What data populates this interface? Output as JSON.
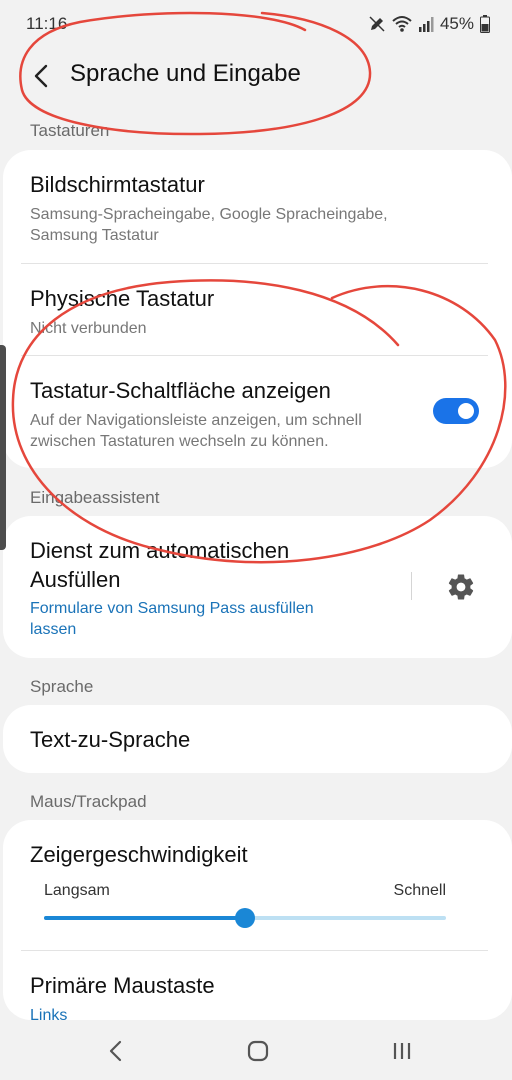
{
  "status_bar": {
    "time": "11:16",
    "battery": "45%",
    "icons": [
      "edit-pen-icon",
      "wifi-icon",
      "signal-icon",
      "battery-icon"
    ]
  },
  "header": {
    "title": "Sprache und Eingabe",
    "back_icon": "back-arrow-icon"
  },
  "sections": {
    "keyboards": "Tastaturen",
    "input_assistant": "Eingabeassistent",
    "language": "Sprache",
    "mouse": "Maus/Trackpad"
  },
  "keyboards_card": {
    "onscreen_title": "Bildschirmtastatur",
    "onscreen_sub_1": "Samsung-Spracheingabe, Google Spracheingabe,",
    "onscreen_sub_2": "Samsung Tastatur",
    "physical_title": "Physische Tastatur",
    "physical_sub": "Nicht verbunden",
    "show_button_title": "Tastatur-Schaltfläche anzeigen",
    "show_button_sub_1": "Auf der Navigationsleiste anzeigen, um schnell",
    "show_button_sub_2": "zwischen Tastaturen wechseln zu können.",
    "show_button_toggle_on": true
  },
  "autofill_card": {
    "title_1": "Dienst zum automatischen",
    "title_2": "Ausfüllen",
    "link_1": "Formulare von Samsung Pass ausfüllen",
    "link_2": "lassen",
    "settings_icon": "gear-icon"
  },
  "tts_card": {
    "title": "Text-zu-Sprache"
  },
  "mouse_card": {
    "pointer_speed_title": "Zeigergeschwindigkeit",
    "slow_label": "Langsam",
    "fast_label": "Schnell",
    "pointer_speed_fraction": 0.5,
    "primary_button_title": "Primäre Maustaste",
    "primary_button_value": "Links"
  },
  "nav_bar": {
    "icons": [
      "nav-back-icon",
      "nav-home-icon",
      "nav-recents-icon"
    ]
  },
  "colors": {
    "accent": "#1a73e8",
    "link": "#1a73b8",
    "annotation": "#e5473c",
    "background": "#f2f2f2"
  }
}
